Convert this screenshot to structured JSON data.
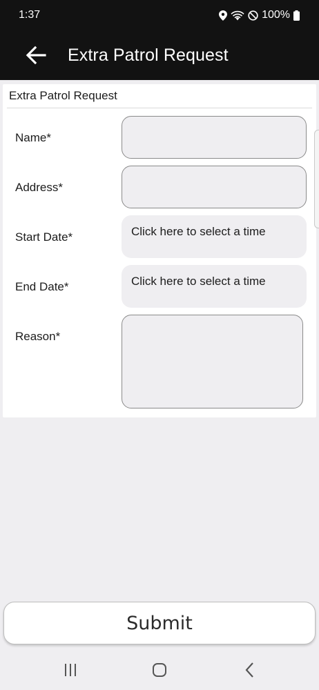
{
  "status_bar": {
    "time": "1:37",
    "battery_text": "100%",
    "icons": [
      "location-icon",
      "wifi-icon",
      "do-not-disturb-icon",
      "battery-icon"
    ]
  },
  "app_bar": {
    "back_icon": "arrow-left-icon",
    "title": "Extra Patrol Request"
  },
  "form": {
    "header": "Extra Patrol Request",
    "fields": {
      "name": {
        "label": "Name*",
        "value": "",
        "placeholder": ""
      },
      "address": {
        "label": "Address*",
        "value": "",
        "placeholder": ""
      },
      "start_date": {
        "label": "Start Date*",
        "value": "Click here to select a time"
      },
      "end_date": {
        "label": "End Date*",
        "value": "Click here to select a time"
      },
      "reason": {
        "label": "Reason*",
        "value": "",
        "placeholder": ""
      }
    }
  },
  "submit": {
    "label": "Submit"
  },
  "nav_bar": {
    "icons": [
      "recent-apps-icon",
      "home-icon",
      "back-icon"
    ]
  },
  "colors": {
    "app_bar": "#121212",
    "background": "#efeef1",
    "card": "#ffffff",
    "field_border": "#8a8a8a"
  }
}
